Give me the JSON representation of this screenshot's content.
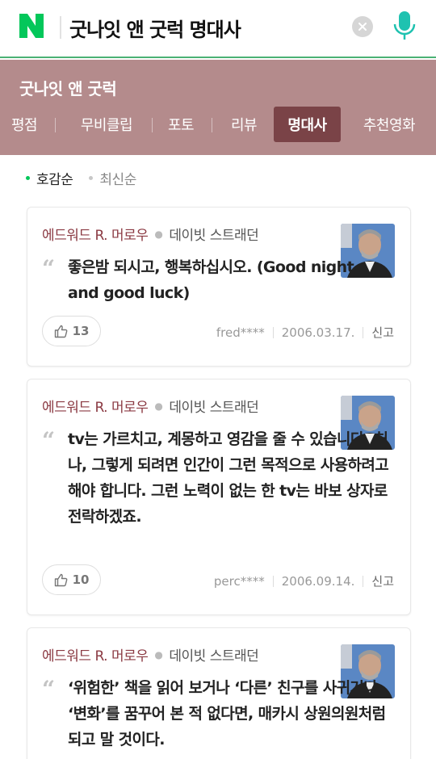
{
  "search": {
    "query": "굿나잇 앤 굿럭 명대사"
  },
  "movie": {
    "title": "굿나잇 앤 굿럭",
    "tabs": [
      {
        "label": "평점",
        "active": false
      },
      {
        "label": "무비클립",
        "active": false
      },
      {
        "label": "포토",
        "active": false
      },
      {
        "label": "리뷰",
        "active": false
      },
      {
        "label": "명대사",
        "active": true
      },
      {
        "label": "추천영화",
        "active": false
      }
    ]
  },
  "sort": {
    "options": [
      "호감순",
      "최신순"
    ],
    "active": "호감순"
  },
  "quotes": [
    {
      "role": "에드워드 R. 머로우",
      "actor": "데이빗 스트래던",
      "text": "좋은밤 되시고, 행복하십시오. (Good night, and good luck)",
      "likes": "13",
      "user": "fred****",
      "date": "2006.03.17.",
      "report": "신고"
    },
    {
      "role": "에드워드 R. 머로우",
      "actor": "데이빗 스트래던",
      "text": "tv는 가르치고, 계몽하고 영감을 줄 수 있습니다. 허나, 그렇게 되려면 인간이 그런 목적으로 사용하려고 해야 합니다. 그런 노력이 없는 한 tv는 바보 상자로 전락하겠죠.",
      "likes": "10",
      "user": "perc****",
      "date": "2006.09.14.",
      "report": "신고"
    },
    {
      "role": "에드워드 R. 머로우",
      "actor": "데이빗 스트래던",
      "text": "‘위험한’ 책을 읽어 보거나 ‘다른’ 친구를 사귀거나 ‘변화’를 꿈꾸어 본 적 없다면, 매카시 상원의원처럼 되고 말 것이다."
    }
  ],
  "colors": {
    "brand_green": "#03c75a",
    "header_bg": "#b48b8c",
    "active_tab_bg": "#7a4347",
    "role_text": "#8b3a43"
  },
  "icons": [
    "naver-logo-icon",
    "clear-icon",
    "mic-icon",
    "quote-icon",
    "thumbs-up-icon",
    "actor-photo"
  ]
}
